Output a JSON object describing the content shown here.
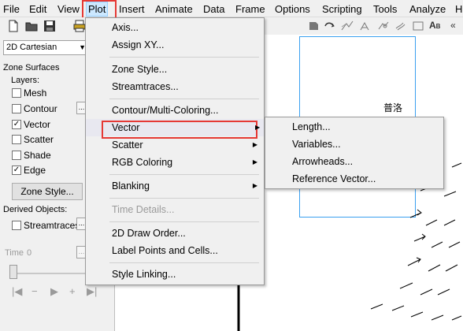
{
  "menubar": {
    "items": [
      "File",
      "Edit",
      "View",
      "Plot",
      "Insert",
      "Animate",
      "Data",
      "Frame",
      "Options",
      "Scripting",
      "Tools",
      "Analyze",
      "H"
    ],
    "active": "Plot"
  },
  "left_panel": {
    "plot_type": "2D Cartesian",
    "zone_surfaces": "Zone Surfaces",
    "layers": "Layers:",
    "layer_items": [
      {
        "label": "Mesh",
        "checked": false
      },
      {
        "label": "Contour",
        "checked": false
      },
      {
        "label": "Vector",
        "checked": true
      },
      {
        "label": "Scatter",
        "checked": false
      },
      {
        "label": "Shade",
        "checked": false
      },
      {
        "label": "Edge",
        "checked": true
      }
    ],
    "zone_style_button": "Zone Style...",
    "derived_objects": "Derived Objects:",
    "streamtraces": {
      "label": "Streamtraces",
      "checked": false
    },
    "time_label": "Time",
    "time_value": "0"
  },
  "workspace": {
    "cjk_text": "普洛"
  },
  "plot_menu": {
    "items": [
      {
        "label": "Axis...",
        "submenu": false,
        "disabled": false
      },
      {
        "label": "Assign XY...",
        "submenu": false,
        "disabled": false
      },
      {
        "label": "Zone Style...",
        "submenu": false,
        "disabled": false
      },
      {
        "label": "Streamtraces...",
        "submenu": false,
        "disabled": false
      },
      {
        "label": "Contour/Multi-Coloring...",
        "submenu": false,
        "disabled": false
      },
      {
        "label": "Vector",
        "submenu": true,
        "disabled": false
      },
      {
        "label": "Scatter",
        "submenu": true,
        "disabled": false
      },
      {
        "label": "RGB Coloring",
        "submenu": true,
        "disabled": false
      },
      {
        "label": "Blanking",
        "submenu": true,
        "disabled": false
      },
      {
        "label": "Time Details...",
        "submenu": false,
        "disabled": true
      },
      {
        "label": "2D Draw Order...",
        "submenu": false,
        "disabled": false
      },
      {
        "label": "Label Points and Cells...",
        "submenu": false,
        "disabled": false
      },
      {
        "label": "Style Linking...",
        "submenu": false,
        "disabled": false
      }
    ]
  },
  "vector_submenu": {
    "items": [
      "Length...",
      "Variables...",
      "Arrowheads...",
      "Reference Vector..."
    ]
  },
  "colors": {
    "highlight_red": "#e53935",
    "frame_blue": "#3aa0f0",
    "active_menu_bg": "#cce8ff"
  }
}
